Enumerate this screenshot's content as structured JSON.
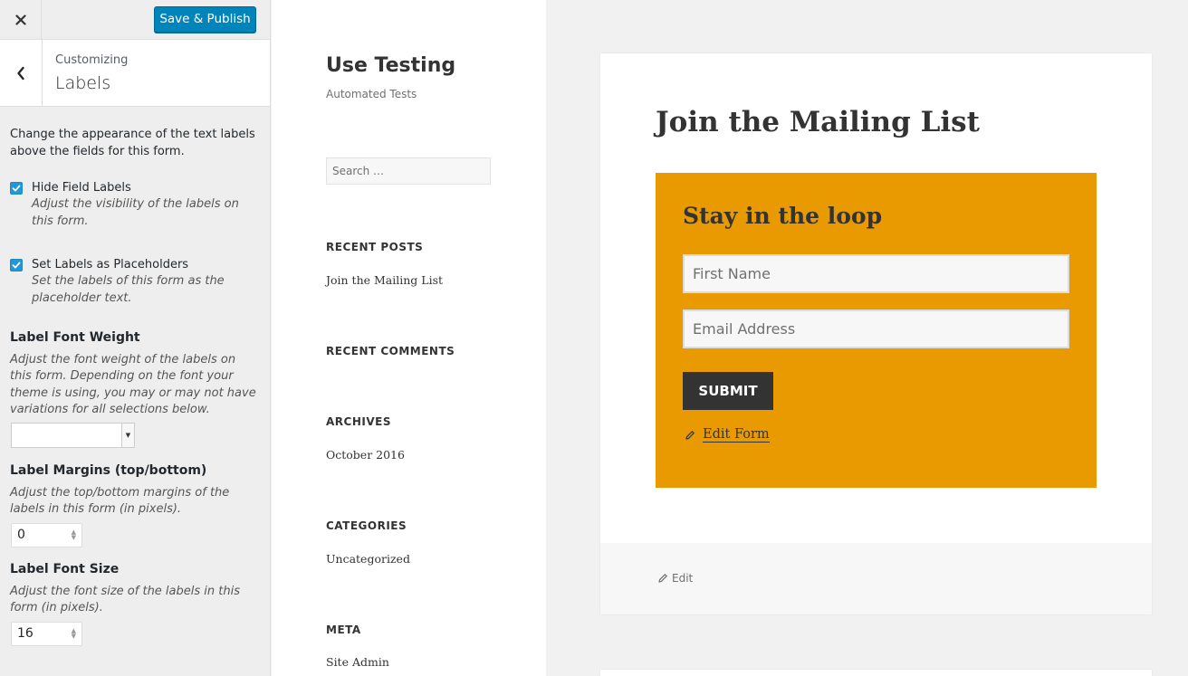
{
  "customizer": {
    "close_icon": "close-icon",
    "publish_label": "Save & Publish",
    "back_icon": "chevron-left-icon",
    "crumb": "Customizing",
    "title": "Labels",
    "description": "Change the appearance of the text labels above the fields for this form.",
    "options": [
      {
        "label": "Hide Field Labels",
        "note": "Adjust the visibility of the labels on this form.",
        "checked": true
      },
      {
        "label": "Set Labels as Placeholders",
        "note": "Set the labels of this form as the placeholder text.",
        "checked": true
      }
    ],
    "font_weight": {
      "title": "Label Font Weight",
      "note": "Adjust the font weight of the labels on this form. Depending on the font your theme is using, you may or may not have variations for all selections below.",
      "selected": ""
    },
    "margins": {
      "title": "Label Margins (top/bottom)",
      "note": "Adjust the top/bottom margins of the labels in this form (in pixels).",
      "value": "0"
    },
    "font_size": {
      "title": "Label Font Size",
      "note": "Adjust the font size of the labels in this form (in pixels).",
      "value": "16"
    },
    "accent_color": "#0085ba"
  },
  "site": {
    "title": "Use Testing",
    "description": "Automated Tests",
    "search_placeholder": "Search …",
    "widgets": {
      "recent_posts": {
        "title": "RECENT POSTS",
        "items": [
          "Join the Mailing List"
        ]
      },
      "recent_comments": {
        "title": "RECENT COMMENTS"
      },
      "archives": {
        "title": "ARCHIVES",
        "items": [
          "October 2016"
        ]
      },
      "categories": {
        "title": "CATEGORIES",
        "items": [
          "Uncategorized"
        ]
      },
      "meta": {
        "title": "META",
        "items": [
          "Site Admin"
        ]
      }
    }
  },
  "article": {
    "title": "Join the Mailing List",
    "form": {
      "heading": "Stay in the loop",
      "background": "#e89a00",
      "first_name_placeholder": "First Name",
      "email_placeholder": "Email Address",
      "submit_label": "SUBMIT",
      "edit_form_label": "Edit Form"
    },
    "footer_edit_label": "Edit"
  }
}
